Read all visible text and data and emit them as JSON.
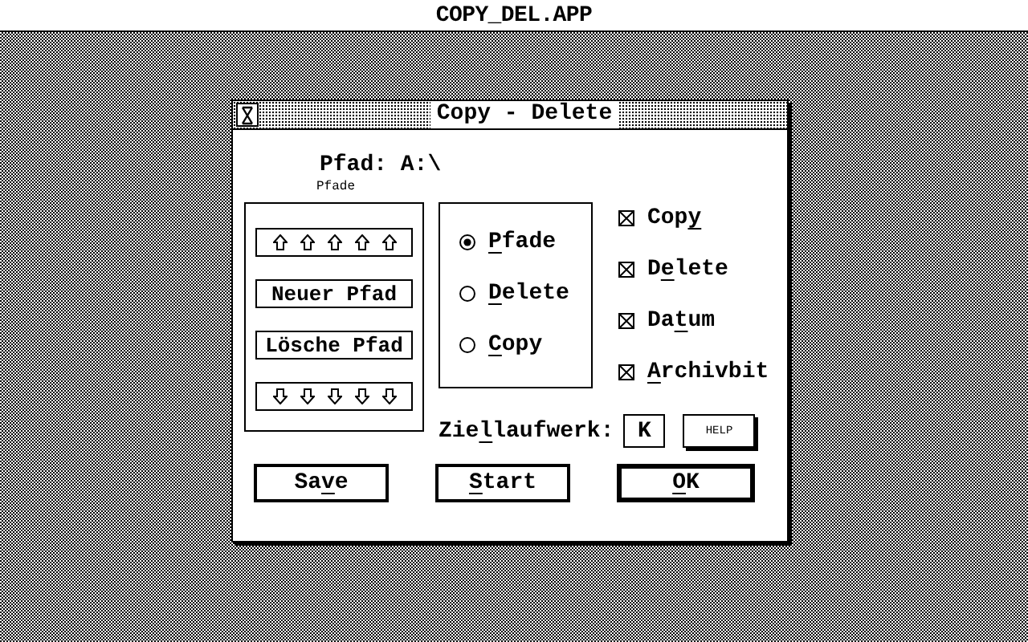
{
  "menu_bar": {
    "title": "COPY_DEL.APP"
  },
  "window": {
    "title": "Copy - Delete",
    "path": "Pfad: A:\\",
    "caption": "Pfade"
  },
  "path_buttons": [
    {
      "kind": "up"
    },
    {
      "kind": "text",
      "label": "Neuer Pfad"
    },
    {
      "kind": "text",
      "label": "Lösche Pfad"
    },
    {
      "kind": "down"
    }
  ],
  "modes": [
    {
      "label": {
        "key": "P",
        "after": "fade"
      },
      "selected": true
    },
    {
      "label": {
        "key": "D",
        "after": "elete"
      },
      "selected": false
    },
    {
      "label": {
        "key": "C",
        "after": "opy"
      },
      "selected": false
    }
  ],
  "options": [
    {
      "label": {
        "before": "Cop",
        "key": "y"
      },
      "checked": true
    },
    {
      "label": {
        "before": "D",
        "key": "e",
        "after": "lete"
      },
      "checked": true
    },
    {
      "label": {
        "before": "Da",
        "key": "t",
        "after": "um"
      },
      "checked": true
    },
    {
      "label": {
        "key": "A",
        "after": "rchivbit"
      },
      "checked": true
    }
  ],
  "target_drive": {
    "label": {
      "before": "Zie",
      "key": "l",
      "after": "laufwerk:"
    },
    "value": "K"
  },
  "help_button": "HELP",
  "buttons": [
    {
      "label": {
        "before": "Sa",
        "key": "v",
        "after": "e"
      },
      "default": false
    },
    {
      "label": {
        "key": "S",
        "after": "tart"
      },
      "default": false
    },
    {
      "label": {
        "key": "O",
        "after": "K"
      },
      "default": true
    }
  ]
}
